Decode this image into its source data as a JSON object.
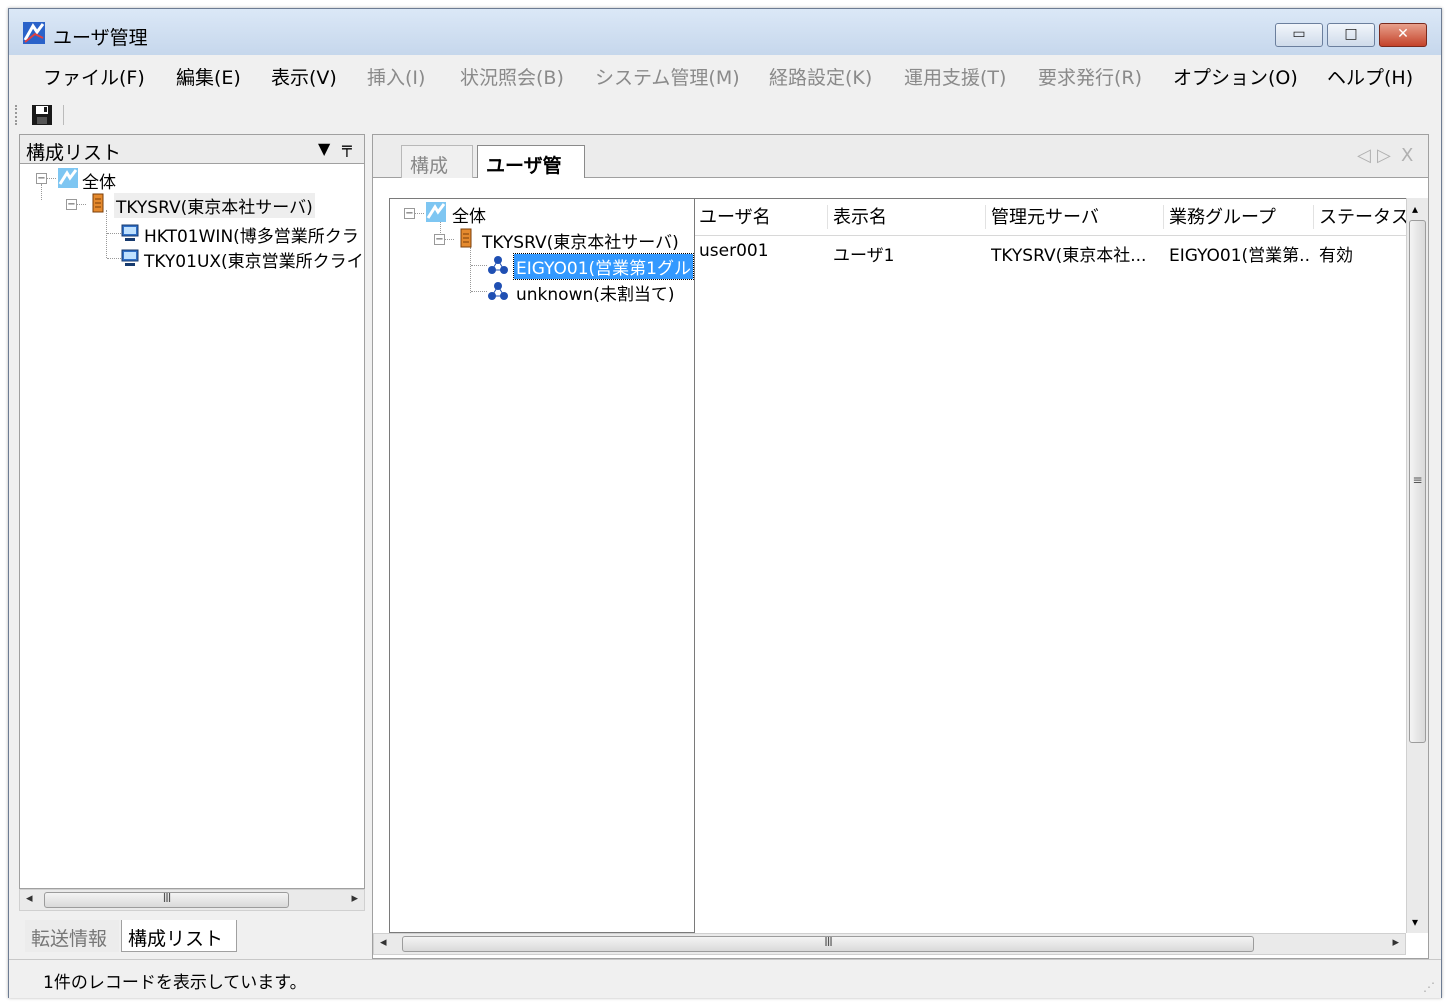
{
  "window": {
    "title": "ユーザ管理",
    "icon": "app-logo-icon",
    "buttons": {
      "minimize": "▭",
      "maximize": "□",
      "close": "✕"
    }
  },
  "menu": [
    {
      "label": "ファイル(F)",
      "enabled": true
    },
    {
      "label": "編集(E)",
      "enabled": true
    },
    {
      "label": "表示(V)",
      "enabled": true
    },
    {
      "label": "挿入(I)",
      "enabled": false
    },
    {
      "label": "状況照会(B)",
      "enabled": false
    },
    {
      "label": "システム管理(M)",
      "enabled": false
    },
    {
      "label": "経路設定(K)",
      "enabled": false
    },
    {
      "label": "運用支援(T)",
      "enabled": false
    },
    {
      "label": "要求発行(R)",
      "enabled": false
    },
    {
      "label": "オプション(O)",
      "enabled": true
    },
    {
      "label": "ヘルプ(H)",
      "enabled": true
    }
  ],
  "toolbar": {
    "save_icon": "save-icon"
  },
  "left_pane": {
    "title": "構成リスト",
    "dropdown_glyph": "▼",
    "pin_glyph": "╤",
    "tree": {
      "root": "全体",
      "server": "TKYSRV(東京本社サーバ)",
      "clients": [
        "HKT01WIN(博多営業所クラ",
        "TKY01UX(東京営業所クライ"
      ]
    },
    "scroll_grip": "III",
    "tabs": {
      "inactive": "転送情報",
      "active": "構成リスト"
    }
  },
  "doc_tabs": {
    "inactive": "構成図",
    "active": "ユーザ管理",
    "nav_prev": "◁",
    "nav_next": "▷",
    "close": "X"
  },
  "inner_tree": {
    "root": "全体",
    "server": "TKYSRV(東京本社サーバ)",
    "groups": [
      "EIGYO01(営業第1グル",
      "unknown(未割当て)"
    ],
    "selected_group": "EIGYO01(営業第1グル"
  },
  "grid": {
    "columns": [
      "ユーザ名",
      "表示名",
      "管理元サーバ",
      "業務グループ",
      "ステータス"
    ],
    "rows": [
      [
        "user001",
        "ユーザ1",
        "TKYSRV(東京本社...",
        "EIGYO01(営業第...",
        "有効"
      ]
    ],
    "scroll_grip": "III",
    "vscroll_grip": "≡"
  },
  "status": {
    "text": "1件のレコードを表示しています。"
  },
  "colors": {
    "selection": "#3399ff",
    "title_bar": "#c6d7ec",
    "close_button": "#c4432a"
  }
}
